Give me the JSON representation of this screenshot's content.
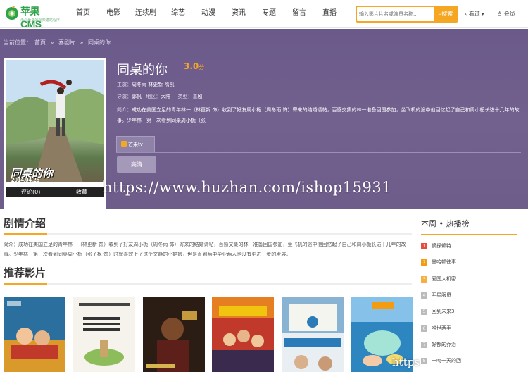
{
  "header": {
    "logo_text": "苹果CMS",
    "logo_slogan": "永久免费的视频建站程序",
    "nav": [
      "首页",
      "电影",
      "连续剧",
      "综艺",
      "动漫",
      "资讯",
      "专题",
      "留言",
      "直播"
    ],
    "search_placeholder": "输入影片片名或演员名称...",
    "search_button": "搜索",
    "history_label": "看过",
    "member_label": "会员"
  },
  "breadcrumb": {
    "prefix": "当前位置：",
    "items": [
      "首页",
      "喜剧片",
      "同桌的你"
    ],
    "separator": "»"
  },
  "poster": {
    "title_art": "同桌的你",
    "date_art": "2014.04.25",
    "comment_label": "评论(0)",
    "fav_label": "收藏"
  },
  "movie": {
    "title": "同桌的你",
    "score": "3.0",
    "score_unit": "分",
    "cast_label": "主演：",
    "cast": "周冬雨  林更新  隋凯",
    "director_label": "导演：",
    "director": "郭帆",
    "area_label": "地区：",
    "area": "大陆",
    "genre_label": "类型：",
    "genre": "喜剧",
    "desc_label": "简介：",
    "desc": "成功在美国立足的青年林一（林更新 饰）收到了好友周小栀（周冬雨 饰）寄来的结婚请帖，百感交集的林一准备回国参加，坐飞机的途中他回忆起了自己和周小栀长达十几年的故事。少年林一第一次看到同桌周小栀（张",
    "source_tab": "芒果tv",
    "play_button": "高清"
  },
  "watermark": "https://www.huzhan.com/ishop15931",
  "watermark_small": "https",
  "plot": {
    "title": "剧情介绍",
    "text": "简介：成功在美国立足的青年林一（林更新 饰）收到了好友周小栀（周冬雨 饰）寄来的结婚请帖，百感交集的林一准备回国参加，坐飞机的途中他回忆起了自己和周小栀长达十几年的故事。少年林一第一次看到同桌周小栀（张子枫 饰）时就喜欢上了这个文静的小姑娘，但是直到两中毕业两人也没有更进一步的发展。"
  },
  "recommend": {
    "title": "推荐影片",
    "covers": [
      "cover-1",
      "cover-2",
      "cover-3",
      "cover-4",
      "cover-5",
      "cover-6"
    ]
  },
  "ranking": {
    "title": "本周 • 热播榜",
    "items": [
      "侦探赖特",
      "曼哈顿往事",
      "爱国大机密",
      "明星服员",
      "回到未来3",
      "唯世两手",
      "好都的乔治",
      "一吻一天的回"
    ],
    "colors": [
      "#e74c3c",
      "#f39c12",
      "#f5b041",
      "#bbb",
      "#bbb",
      "#bbb",
      "#bbb",
      "#bbb"
    ]
  },
  "colors": {
    "accent": "#f5a623",
    "banner": "#6e5c8a",
    "logo_green": "#2fa24a"
  }
}
